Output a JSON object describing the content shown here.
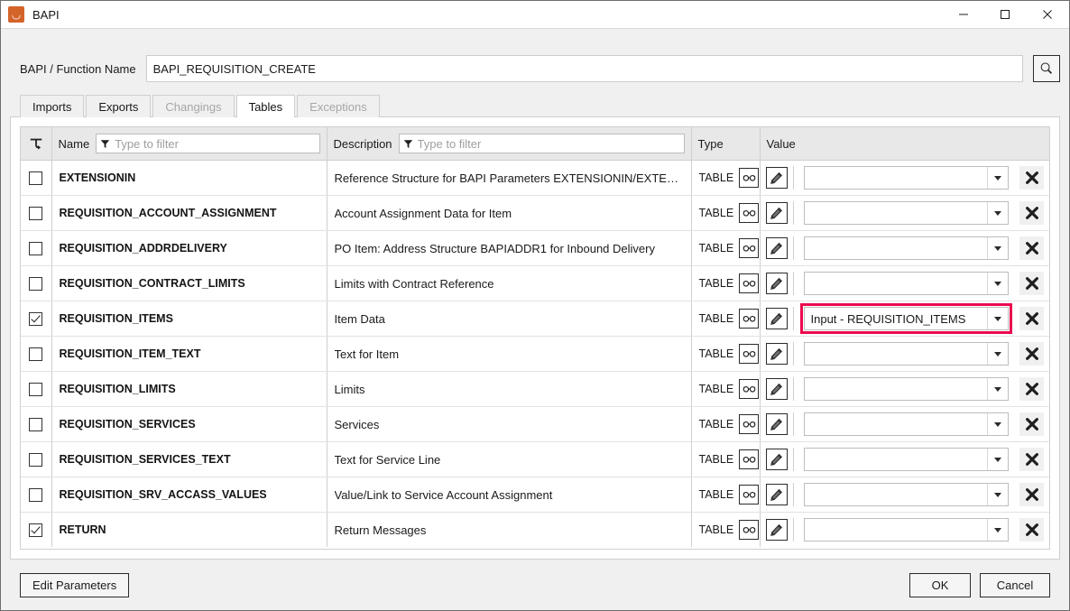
{
  "window": {
    "title": "BAPI",
    "app_icon": "bapi-app-icon",
    "minimize_label": "–",
    "maximize_label": "□",
    "close_label": "✕",
    "accent_color": "#d4632a",
    "highlight_color": "#ec0a4f"
  },
  "function_bar": {
    "label": "BAPI / Function Name",
    "value": "BAPI_REQUISITION_CREATE",
    "placeholder": "",
    "search_icon": "search-icon"
  },
  "tabs": [
    {
      "label": "Imports",
      "state": "enabled"
    },
    {
      "label": "Exports",
      "state": "enabled"
    },
    {
      "label": "Changings",
      "state": "disabled"
    },
    {
      "label": "Tables",
      "state": "active"
    },
    {
      "label": "Exceptions",
      "state": "disabled"
    }
  ],
  "grid": {
    "reset_filter_icon": "reset-filter-icon",
    "columns": {
      "name": "Name",
      "description": "Description",
      "type": "Type",
      "value": "Value"
    },
    "filters": {
      "name_placeholder": "Type to filter",
      "name_value": "",
      "description_placeholder": "Type to filter",
      "description_value": ""
    },
    "rows": [
      {
        "checked": false,
        "name": "EXTENSIONIN",
        "description": "Reference Structure for BAPI Parameters EXTENSIONIN/EXTENSIONOUT",
        "type": "TABLE",
        "value": "",
        "highlighted": false
      },
      {
        "checked": false,
        "name": "REQUISITION_ACCOUNT_ASSIGNMENT",
        "description": "Account Assignment Data for Item",
        "type": "TABLE",
        "value": "",
        "highlighted": false
      },
      {
        "checked": false,
        "name": "REQUISITION_ADDRDELIVERY",
        "description": "PO Item: Address Structure BAPIADDR1 for Inbound Delivery",
        "type": "TABLE",
        "value": "",
        "highlighted": false
      },
      {
        "checked": false,
        "name": "REQUISITION_CONTRACT_LIMITS",
        "description": "Limits with Contract Reference",
        "type": "TABLE",
        "value": "",
        "highlighted": false
      },
      {
        "checked": true,
        "name": "REQUISITION_ITEMS",
        "description": "Item Data",
        "type": "TABLE",
        "value": "Input - REQUISITION_ITEMS",
        "highlighted": true
      },
      {
        "checked": false,
        "name": "REQUISITION_ITEM_TEXT",
        "description": "Text for Item",
        "type": "TABLE",
        "value": "",
        "highlighted": false
      },
      {
        "checked": false,
        "name": "REQUISITION_LIMITS",
        "description": "Limits",
        "type": "TABLE",
        "value": "",
        "highlighted": false
      },
      {
        "checked": false,
        "name": "REQUISITION_SERVICES",
        "description": "Services",
        "type": "TABLE",
        "value": "",
        "highlighted": false
      },
      {
        "checked": false,
        "name": "REQUISITION_SERVICES_TEXT",
        "description": "Text for Service Line",
        "type": "TABLE",
        "value": "",
        "highlighted": false
      },
      {
        "checked": false,
        "name": "REQUISITION_SRV_ACCASS_VALUES",
        "description": "Value/Link to Service Account Assignment",
        "type": "TABLE",
        "value": "",
        "highlighted": false
      },
      {
        "checked": true,
        "name": "RETURN",
        "description": "Return Messages",
        "type": "TABLE",
        "value": "",
        "highlighted": false
      }
    ],
    "row_icons": {
      "structure_icon": "glasses-icon",
      "edit_icon": "pencil-icon",
      "dropdown_icon": "chevron-down-icon",
      "clear_icon": "clear-x-icon"
    }
  },
  "footer": {
    "edit_parameters_label": "Edit Parameters",
    "ok_label": "OK",
    "cancel_label": "Cancel"
  }
}
